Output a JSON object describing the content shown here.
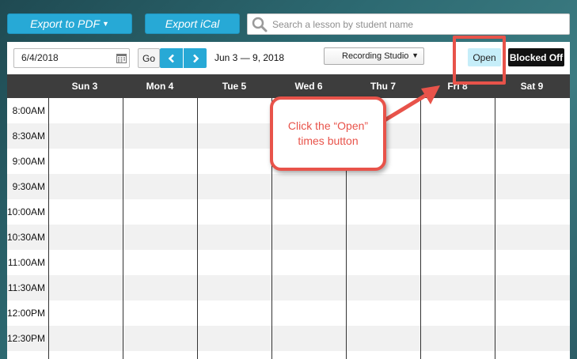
{
  "toolbar_top": {
    "export_pdf_label": "Export to PDF",
    "export_ical_label": "Export iCal",
    "search_placeholder": "Search a lesson by student name"
  },
  "controls": {
    "date_value": "6/4/2018",
    "go_label": "Go",
    "prev_icon": "chevron-left-icon",
    "next_icon": "chevron-right-icon",
    "date_range": "Jun 3 — 9, 2018",
    "room_selected": "Recording Studio",
    "open_label": "Open",
    "blocked_label": "Blocked Off"
  },
  "calendar": {
    "days": [
      "Sun 3",
      "Mon 4",
      "Tue 5",
      "Wed 6",
      "Thu 7",
      "Fri 8",
      "Sat 9"
    ],
    "times": [
      "8:00AM",
      "8:30AM",
      "9:00AM",
      "9:30AM",
      "10:00AM",
      "10:30AM",
      "11:00AM",
      "11:30AM",
      "12:00PM",
      "12:30PM"
    ]
  },
  "annotation": {
    "callout_text": "Click the “Open” times button"
  },
  "colors": {
    "accent": "#27a9d6",
    "open_bg": "#c6eef9",
    "annotation": "#e8534a",
    "header_bg": "#3d3d3d"
  }
}
